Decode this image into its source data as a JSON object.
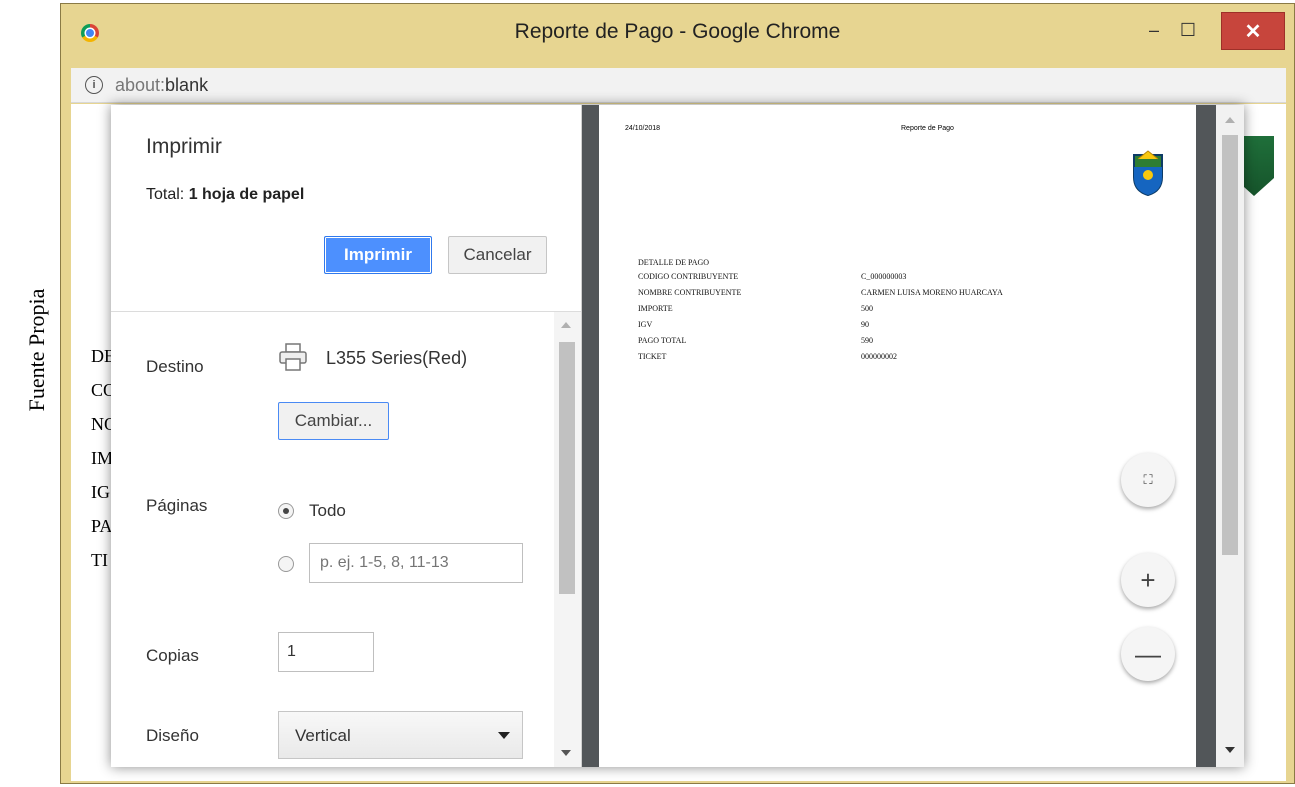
{
  "caption": "Fuente Propia",
  "window": {
    "title": "Reporte de Pago - Google Chrome",
    "minimize_glyph": "–",
    "maximize_glyph": "☐",
    "close_glyph": "✕"
  },
  "addressbar": {
    "info_glyph": "i",
    "url_scheme": "about:",
    "url_rest": "blank"
  },
  "background_page": {
    "labels": [
      "DE",
      "CO",
      "NO",
      "IM",
      "IG",
      "PA",
      "TI"
    ]
  },
  "print_panel": {
    "title": "Imprimir",
    "total_prefix": "Total: ",
    "total_value": "1 hoja de papel",
    "print_button": "Imprimir",
    "cancel_button": "Cancelar",
    "destination_label": "Destino",
    "destination_value": "L355 Series(Red)",
    "change_button": "Cambiar...",
    "pages_label": "Páginas",
    "pages_all": "Todo",
    "pages_all_selected": true,
    "pages_range_placeholder": "p. ej. 1-5, 8, 11-13",
    "copies_label": "Copias",
    "copies_value": "1",
    "layout_label": "Diseño",
    "layout_value": "Vertical"
  },
  "preview": {
    "date": "24/10/2018",
    "title": "Reporte de Pago",
    "section": "DETALLE DE PAGO",
    "rows": [
      {
        "label": "CODIGO CONTRIBUYENTE",
        "value": "C_000000003"
      },
      {
        "label": "NOMBRE CONTRIBUYENTE",
        "value": "CARMEN LUISA MORENO HUARCAYA"
      },
      {
        "label": "IMPORTE",
        "value": "500"
      },
      {
        "label": "IGV",
        "value": "90"
      },
      {
        "label": "PAGO TOTAL",
        "value": "590"
      },
      {
        "label": "TICKET",
        "value": "000000002"
      }
    ],
    "fit_glyph": "⛶",
    "zoom_in_glyph": "+",
    "zoom_out_glyph": "—"
  },
  "colors": {
    "window_frame": "#e7d591",
    "primary_button": "#4d90fe",
    "close_button": "#c7453c",
    "preview_background": "#525659"
  }
}
